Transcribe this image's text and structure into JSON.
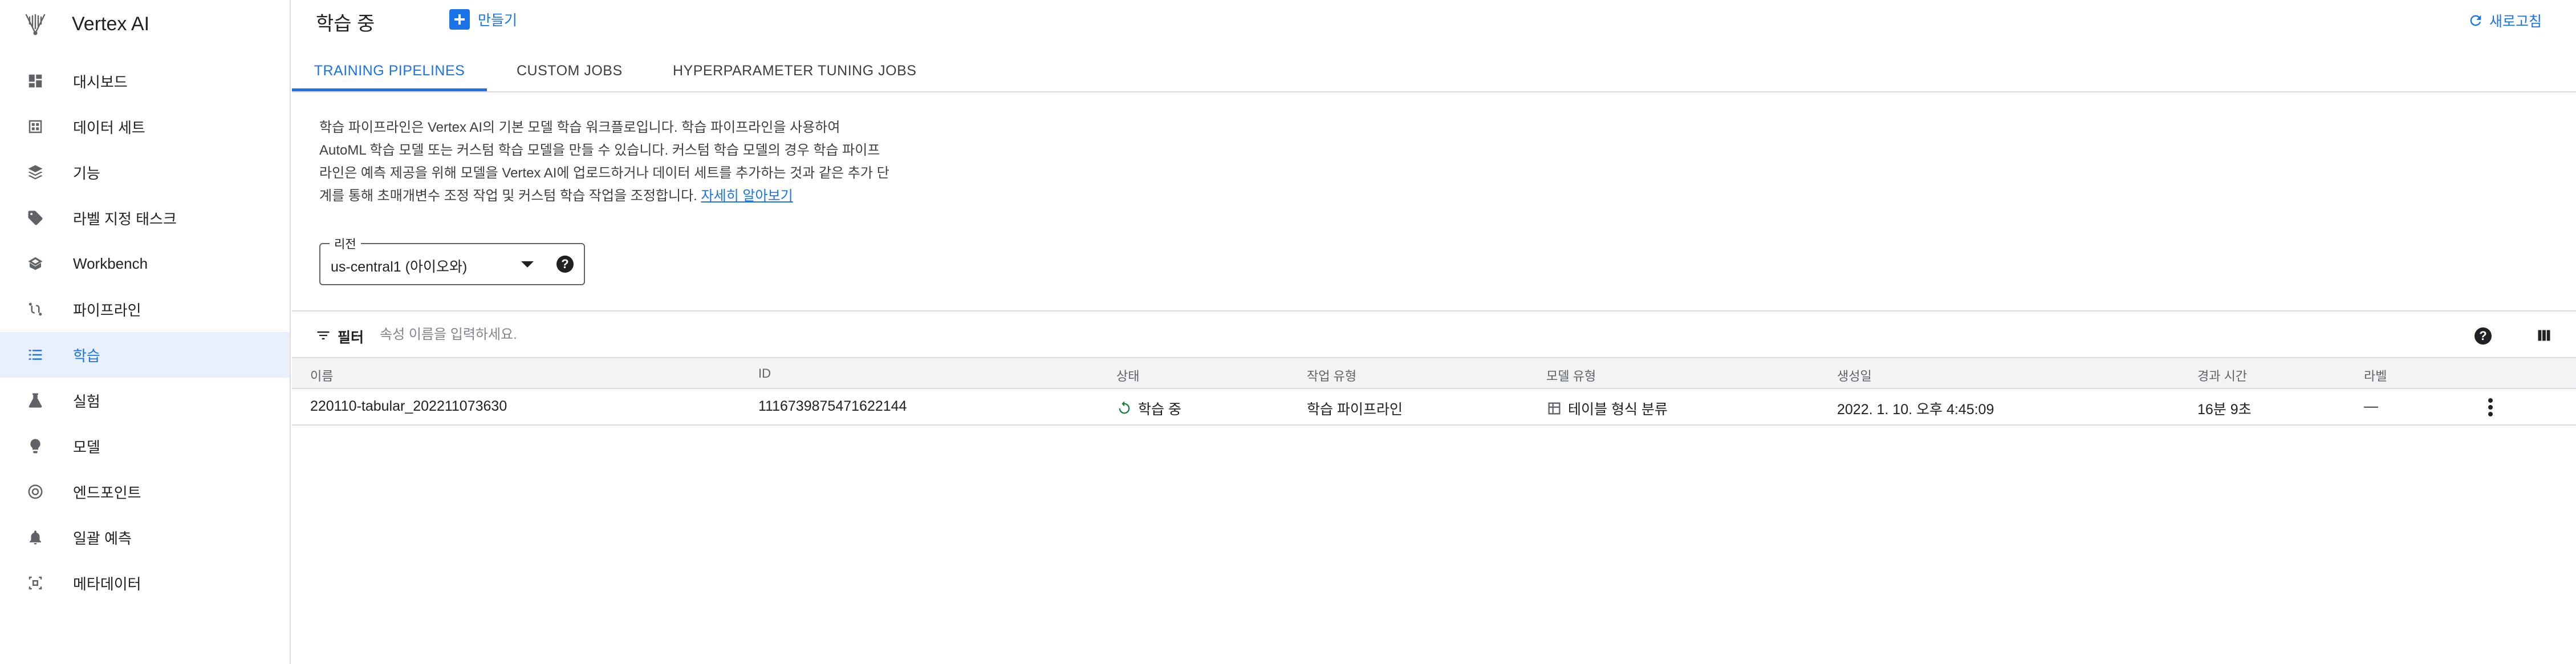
{
  "app": {
    "name": "Vertex AI"
  },
  "sidebar": {
    "items": [
      {
        "label": "대시보드",
        "icon": "dashboard-icon"
      },
      {
        "label": "데이터 세트",
        "icon": "dataset-icon"
      },
      {
        "label": "기능",
        "icon": "layers-icon"
      },
      {
        "label": "라벨 지정 태스크",
        "icon": "tag-icon"
      },
      {
        "label": "Workbench",
        "icon": "workbench-icon"
      },
      {
        "label": "파이프라인",
        "icon": "pipeline-icon"
      },
      {
        "label": "학습",
        "icon": "list-icon",
        "active": true
      },
      {
        "label": "실험",
        "icon": "flask-icon"
      },
      {
        "label": "모델",
        "icon": "lightbulb-icon"
      },
      {
        "label": "엔드포인트",
        "icon": "target-icon"
      },
      {
        "label": "일괄 예측",
        "icon": "bell-icon"
      },
      {
        "label": "메타데이터",
        "icon": "metadata-icon"
      }
    ]
  },
  "header": {
    "title": "학습 중",
    "create_label": "만들기",
    "refresh_label": "새로고침"
  },
  "tabs": [
    {
      "label": "TRAINING PIPELINES",
      "active": true
    },
    {
      "label": "CUSTOM JOBS"
    },
    {
      "label": "HYPERPARAMETER TUNING JOBS"
    }
  ],
  "description": {
    "line1": "학습 파이프라인은 Vertex AI의 기본 모델 학습 워크플로입니다. 학습 파이프라인을 사용하여",
    "line2": "AutoML 학습 모델 또는 커스텀 학습 모델을 만들 수 있습니다. 커스텀 학습 모델의 경우 학습 파이프",
    "line3": "라인은 예측 제공을 위해 모델을 Vertex AI에 업로드하거나 데이터 세트를 추가하는 것과 같은 추가 단",
    "line4": "계를 통해 초매개변수 조정 작업 및 커스텀 학습 작업을 조정합니다. ",
    "link": "자세히 알아보기"
  },
  "region": {
    "label": "리전",
    "value": "us-central1 (아이오와)"
  },
  "filter": {
    "label": "필터",
    "placeholder": "속성 이름을 입력하세요."
  },
  "table": {
    "columns": [
      "이름",
      "ID",
      "상태",
      "작업 유형",
      "모델 유형",
      "생성일",
      "경과 시간",
      "라벨"
    ],
    "rows": [
      {
        "name": "220110-tabular_202211073630",
        "id": "1116739875471622144",
        "status": "학습 중",
        "job_type": "학습 파이프라인",
        "model_type": "테이블 형식 분류",
        "created": "2022. 1. 10. 오후 4:45:09",
        "elapsed": "16분 9초",
        "label": "—"
      }
    ]
  },
  "colors": {
    "accent": "#1a73e8",
    "status_running": "#188038"
  }
}
